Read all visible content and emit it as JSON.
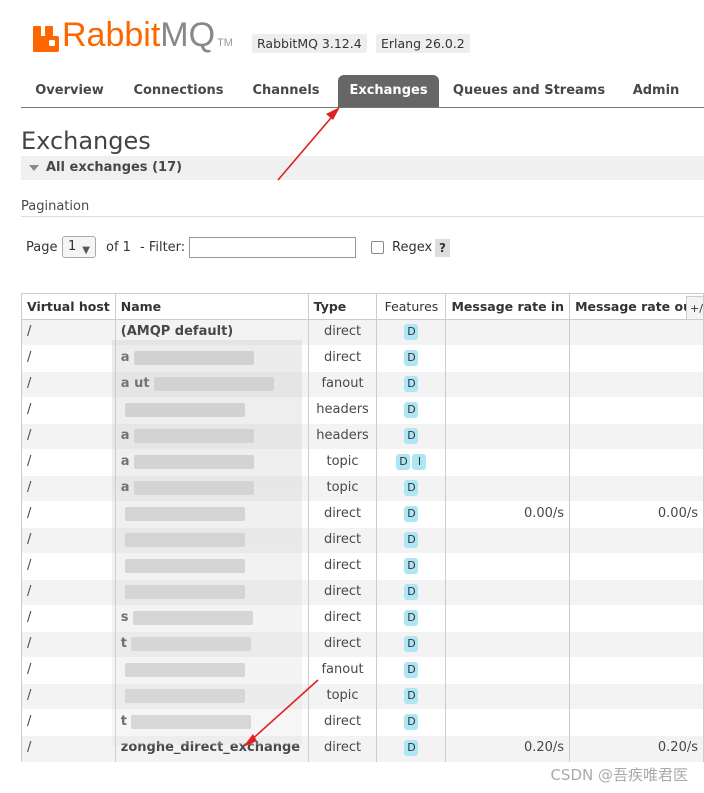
{
  "header": {
    "logo_rabbit": "Rabbit",
    "logo_mq": "MQ",
    "logo_tm": "TM",
    "version_badges": [
      "RabbitMQ 3.12.4",
      "Erlang 26.0.2"
    ],
    "brand_color": "#ff6600"
  },
  "tabs": [
    {
      "label": "Overview",
      "active": false
    },
    {
      "label": "Connections",
      "active": false
    },
    {
      "label": "Channels",
      "active": false
    },
    {
      "label": "Exchanges",
      "active": true
    },
    {
      "label": "Queues and Streams",
      "active": false
    },
    {
      "label": "Admin",
      "active": false
    }
  ],
  "page": {
    "title": "Exchanges",
    "section_label": "All exchanges (17)",
    "pagination_label": "Pagination",
    "page_label": "Page",
    "page_value": "1",
    "of_label": "of 1",
    "filter_label": "- Filter:",
    "filter_value": "",
    "regex_label": "Regex",
    "help_label": "?",
    "columns_toggle": "+/-"
  },
  "table": {
    "headers": [
      "Virtual host",
      "Name",
      "Type",
      "Features",
      "Message rate in",
      "Message rate out"
    ],
    "rows": [
      {
        "vhost": "/",
        "name": "(AMQP default)",
        "name_obscured": false,
        "type": "direct",
        "features": [
          "D"
        ],
        "rate_in": "",
        "rate_out": ""
      },
      {
        "vhost": "/",
        "name": "a",
        "name_obscured": true,
        "type": "direct",
        "features": [
          "D"
        ],
        "rate_in": "",
        "rate_out": ""
      },
      {
        "vhost": "/",
        "name": "a    ut",
        "name_obscured": true,
        "type": "fanout",
        "features": [
          "D"
        ],
        "rate_in": "",
        "rate_out": ""
      },
      {
        "vhost": "/",
        "name": "",
        "name_obscured": true,
        "type": "headers",
        "features": [
          "D"
        ],
        "rate_in": "",
        "rate_out": ""
      },
      {
        "vhost": "/",
        "name": "a",
        "name_obscured": true,
        "type": "headers",
        "features": [
          "D"
        ],
        "rate_in": "",
        "rate_out": ""
      },
      {
        "vhost": "/",
        "name": "a",
        "name_obscured": true,
        "type": "topic",
        "features": [
          "D",
          "I"
        ],
        "rate_in": "",
        "rate_out": ""
      },
      {
        "vhost": "/",
        "name": "a",
        "name_obscured": true,
        "type": "topic",
        "features": [
          "D"
        ],
        "rate_in": "",
        "rate_out": ""
      },
      {
        "vhost": "/",
        "name": "",
        "name_obscured": true,
        "type": "direct",
        "features": [
          "D"
        ],
        "rate_in": "0.00/s",
        "rate_out": "0.00/s"
      },
      {
        "vhost": "/",
        "name": "",
        "name_obscured": true,
        "type": "direct",
        "features": [
          "D"
        ],
        "rate_in": "",
        "rate_out": ""
      },
      {
        "vhost": "/",
        "name": "",
        "name_obscured": true,
        "type": "direct",
        "features": [
          "D"
        ],
        "rate_in": "",
        "rate_out": ""
      },
      {
        "vhost": "/",
        "name": "",
        "name_obscured": true,
        "type": "direct",
        "features": [
          "D"
        ],
        "rate_in": "",
        "rate_out": ""
      },
      {
        "vhost": "/",
        "name": "s",
        "name_obscured": true,
        "type": "direct",
        "features": [
          "D"
        ],
        "rate_in": "",
        "rate_out": ""
      },
      {
        "vhost": "/",
        "name": "t",
        "name_obscured": true,
        "type": "direct",
        "features": [
          "D"
        ],
        "rate_in": "",
        "rate_out": ""
      },
      {
        "vhost": "/",
        "name": "",
        "name_obscured": true,
        "type": "fanout",
        "features": [
          "D"
        ],
        "rate_in": "",
        "rate_out": ""
      },
      {
        "vhost": "/",
        "name": "",
        "name_obscured": true,
        "type": "topic",
        "features": [
          "D"
        ],
        "rate_in": "",
        "rate_out": ""
      },
      {
        "vhost": "/",
        "name": "t",
        "name_obscured": true,
        "type": "direct",
        "features": [
          "D"
        ],
        "rate_in": "",
        "rate_out": ""
      },
      {
        "vhost": "/",
        "name": "zonghe_direct_exchange",
        "name_obscured": false,
        "type": "direct",
        "features": [
          "D"
        ],
        "rate_in": "0.20/s",
        "rate_out": "0.20/s"
      }
    ]
  },
  "watermark": "CSDN @吾疾唯君医",
  "annotation_color": "#e02020"
}
